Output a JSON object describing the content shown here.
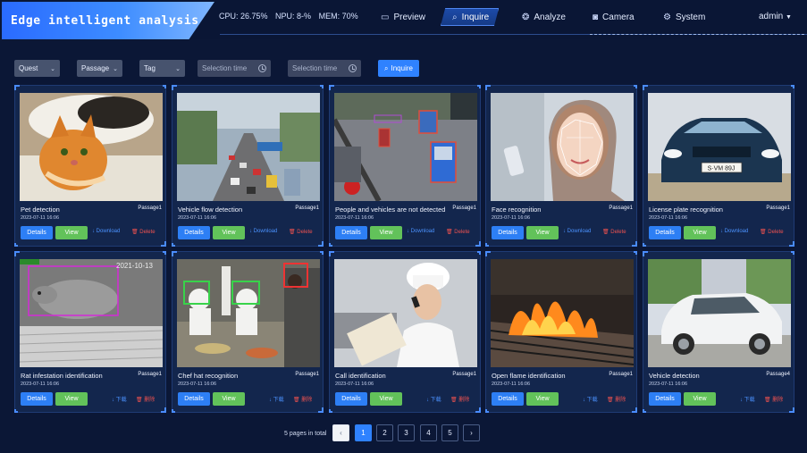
{
  "header": {
    "title": "Edge intelligent analysis platform",
    "cpu": "CPU: 26.75%",
    "npu": "NPU: 8-%",
    "mem": "MEM: 70%",
    "nav": [
      {
        "label": "Preview",
        "icon": "monitor-icon"
      },
      {
        "label": "Inquire",
        "icon": "search-doc-icon"
      },
      {
        "label": "Analyze",
        "icon": "brain-icon"
      },
      {
        "label": "Camera",
        "icon": "camera-icon"
      },
      {
        "label": "System",
        "icon": "gear-icon"
      }
    ],
    "user": "admin"
  },
  "filters": {
    "quest": "Quest",
    "passage": "Passage",
    "tag": "Tag",
    "start_placeholder": "Selection time",
    "end_placeholder": "Selection time",
    "inquire": "Inquire"
  },
  "actions": {
    "details": "Details",
    "view": "View",
    "download_en": "Download",
    "delete_en": "Delete",
    "download_cn": "下载",
    "delete_cn": "删除"
  },
  "cards": [
    {
      "name": "Pet detection",
      "passage": "Passage1",
      "time": "2023-07-11 16:06",
      "lang": "en"
    },
    {
      "name": "Vehicle flow detection",
      "passage": "Passage1",
      "time": "2023-07-11 16:06",
      "lang": "en"
    },
    {
      "name": "People and vehicles are not detected",
      "passage": "Passage1",
      "time": "2023-07-11 16:06",
      "lang": "en"
    },
    {
      "name": "Face recognition",
      "passage": "Passage1",
      "time": "2023-07-11 16:06",
      "lang": "en"
    },
    {
      "name": "License plate recognition",
      "passage": "Passage1",
      "time": "2023-07-11 16:06",
      "lang": "en",
      "plate": "S·VM 89J"
    },
    {
      "name": "Rat infestation identification",
      "passage": "Passage1",
      "time": "2023-07-11 16:06",
      "lang": "cn",
      "overlay": "2021-10-13"
    },
    {
      "name": "Chef hat recognition",
      "passage": "Passage1",
      "time": "2023-07-11 16:06",
      "lang": "cn"
    },
    {
      "name": "Call identification",
      "passage": "Passage1",
      "time": "2023-07-11 16:06",
      "lang": "cn"
    },
    {
      "name": "Open flame identification",
      "passage": "Passage1",
      "time": "2023-07-11 16:06",
      "lang": "cn"
    },
    {
      "name": "Vehicle detection",
      "passage": "Passage4",
      "time": "2023-07-11 16:06",
      "lang": "cn"
    }
  ],
  "pagination": {
    "total_text": "5 pages in total",
    "pages": [
      "1",
      "2",
      "3",
      "4",
      "5"
    ],
    "current": "1"
  }
}
